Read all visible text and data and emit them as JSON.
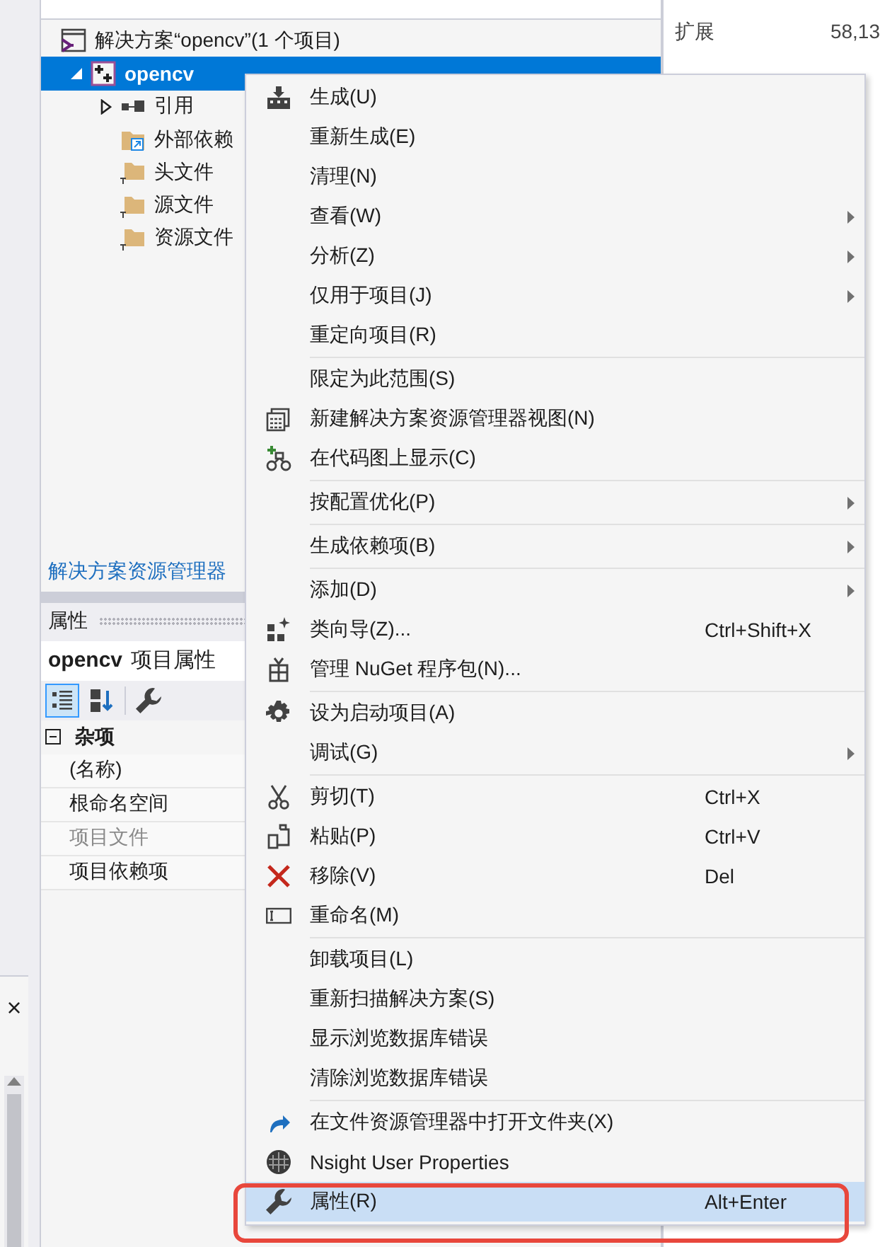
{
  "explorer": {
    "tree": [
      {
        "label": "解决方案“opencv”(1 个项目)",
        "kind": "solution",
        "selected": false,
        "children": [
          {
            "label": "opencv",
            "kind": "project",
            "selected": true,
            "expanded": true,
            "children": [
              {
                "label": "引用",
                "kind": "references",
                "selected": false,
                "expanded": false
              },
              {
                "label": "外部依赖",
                "kind": "external",
                "selected": false
              },
              {
                "label": "头文件",
                "kind": "folder",
                "selected": false
              },
              {
                "label": "源文件",
                "kind": "folder",
                "selected": false
              },
              {
                "label": "资源文件",
                "kind": "folder",
                "selected": false
              }
            ]
          }
        ]
      }
    ],
    "footer_link": "解决方案资源管理器"
  },
  "side_panel": {
    "label": "扩展",
    "value": "58,13"
  },
  "left_strip": {
    "close_glyph": "×"
  },
  "properties": {
    "title": "属性",
    "object_name": "opencv",
    "object_type": "项目属性",
    "toolbar": [
      {
        "kind": "categorized",
        "selected": true
      },
      {
        "kind": "alphabetical",
        "selected": false
      },
      {
        "kind": "property-pages",
        "selected": false
      }
    ],
    "categories": [
      {
        "name": "杂项",
        "expanded": true,
        "rows": [
          {
            "name": "(名称)",
            "disabled": false
          },
          {
            "name": "根命名空间",
            "disabled": false
          },
          {
            "name": "项目文件",
            "disabled": true
          },
          {
            "name": "项目依赖项",
            "disabled": false
          }
        ]
      }
    ]
  },
  "context_menu": {
    "items": [
      {
        "kind": "item",
        "label": "生成(U)",
        "submenu": false,
        "selected": false
      },
      {
        "kind": "item",
        "label": "重新生成(E)",
        "submenu": false,
        "selected": false
      },
      {
        "kind": "item",
        "label": "清理(N)",
        "submenu": false,
        "selected": false
      },
      {
        "kind": "item",
        "label": "查看(W)",
        "submenu": true,
        "selected": false
      },
      {
        "kind": "item",
        "label": "分析(Z)",
        "submenu": true,
        "selected": false
      },
      {
        "kind": "item",
        "label": "仅用于项目(J)",
        "submenu": true,
        "selected": false
      },
      {
        "kind": "item",
        "label": "重定向项目(R)",
        "submenu": false,
        "selected": false
      },
      {
        "kind": "separator"
      },
      {
        "kind": "item",
        "label": "限定为此范围(S)",
        "submenu": false,
        "selected": false
      },
      {
        "kind": "item",
        "label": "新建解决方案资源管理器视图(N)",
        "submenu": false,
        "selected": false
      },
      {
        "kind": "item",
        "label": "在代码图上显示(C)",
        "submenu": false,
        "selected": false
      },
      {
        "kind": "separator"
      },
      {
        "kind": "item",
        "label": "按配置优化(P)",
        "submenu": true,
        "selected": false
      },
      {
        "kind": "separator"
      },
      {
        "kind": "item",
        "label": "生成依赖项(B)",
        "submenu": true,
        "selected": false
      },
      {
        "kind": "separator"
      },
      {
        "kind": "item",
        "label": "添加(D)",
        "submenu": true,
        "selected": false
      },
      {
        "kind": "item",
        "label": "类向导(Z)...",
        "shortcut": "Ctrl+Shift+X",
        "submenu": false,
        "selected": false
      },
      {
        "kind": "item",
        "label": "管理 NuGet 程序包(N)...",
        "submenu": false,
        "selected": false
      },
      {
        "kind": "separator"
      },
      {
        "kind": "item",
        "label": "设为启动项目(A)",
        "submenu": false,
        "selected": false
      },
      {
        "kind": "item",
        "label": "调试(G)",
        "submenu": true,
        "selected": false
      },
      {
        "kind": "separator"
      },
      {
        "kind": "item",
        "label": "剪切(T)",
        "shortcut": "Ctrl+X",
        "submenu": false,
        "selected": false
      },
      {
        "kind": "item",
        "label": "粘贴(P)",
        "shortcut": "Ctrl+V",
        "submenu": false,
        "selected": false
      },
      {
        "kind": "item",
        "label": "移除(V)",
        "shortcut": "Del",
        "submenu": false,
        "selected": false
      },
      {
        "kind": "item",
        "label": "重命名(M)",
        "submenu": false,
        "selected": false
      },
      {
        "kind": "separator"
      },
      {
        "kind": "item",
        "label": "卸载项目(L)",
        "submenu": false,
        "selected": false
      },
      {
        "kind": "item",
        "label": "重新扫描解决方案(S)",
        "submenu": false,
        "selected": false
      },
      {
        "kind": "item",
        "label": "显示浏览数据库错误",
        "submenu": false,
        "selected": false
      },
      {
        "kind": "item",
        "label": "清除浏览数据库错误",
        "submenu": false,
        "selected": false
      },
      {
        "kind": "separator"
      },
      {
        "kind": "item",
        "label": "在文件资源管理器中打开文件夹(X)",
        "submenu": false,
        "selected": false
      },
      {
        "kind": "item",
        "label": "Nsight User Properties",
        "submenu": false,
        "selected": false
      },
      {
        "kind": "item",
        "label": "属性(R)",
        "shortcut": "Alt+Enter",
        "submenu": false,
        "selected": true
      }
    ]
  }
}
